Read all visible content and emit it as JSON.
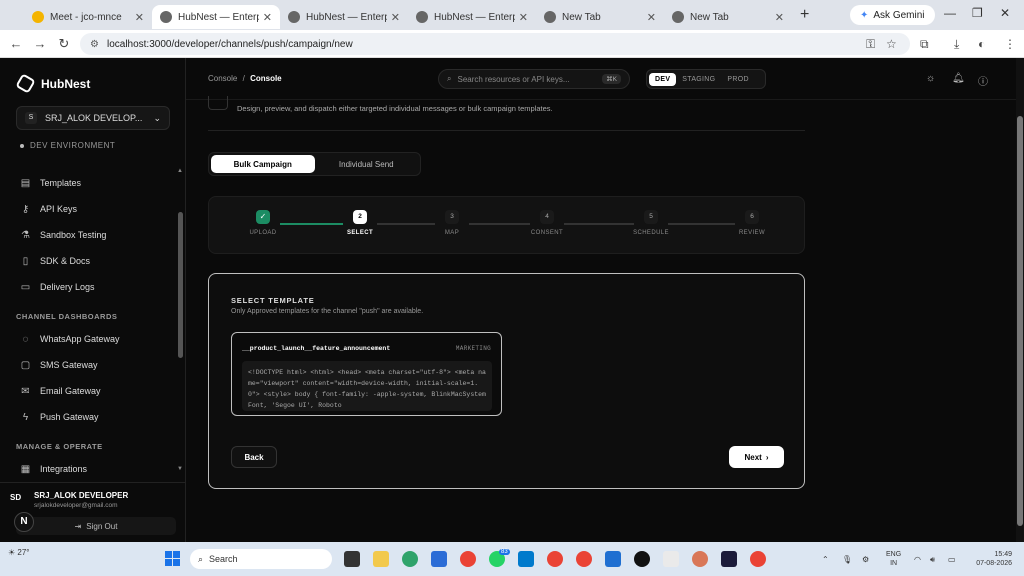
{
  "browser": {
    "tabs": [
      {
        "label": "Meet - jco-mnce",
        "color": "#f4b400",
        "active": false
      },
      {
        "label": "HubNest — Enterprise",
        "color": "#666666",
        "active": true
      },
      {
        "label": "HubNest — Enterprise",
        "color": "#666666",
        "active": false
      },
      {
        "label": "HubNest — Enterprise",
        "color": "#666666",
        "active": false
      },
      {
        "label": "New Tab",
        "color": "#666666",
        "active": false
      },
      {
        "label": "New Tab",
        "color": "#666666",
        "active": false
      }
    ],
    "ask_gemini": "Ask Gemini",
    "url": "localhost:3000/developer/channels/push/campaign/new"
  },
  "sidebar": {
    "brand": "HubNest",
    "env_avatar": "S",
    "env_select": "SRJ_ALOK DEVELOP...",
    "env_label": "DEV ENVIRONMENT",
    "items": [
      {
        "label": "Templates",
        "icon": "document-icon"
      },
      {
        "label": "API Keys",
        "icon": "key-icon"
      },
      {
        "label": "Sandbox Testing",
        "icon": "flask-icon"
      },
      {
        "label": "SDK & Docs",
        "icon": "book-icon"
      },
      {
        "label": "Delivery Logs",
        "icon": "file-icon"
      }
    ],
    "section_channels": "CHANNEL DASHBOARDS",
    "channels": [
      {
        "label": "WhatsApp Gateway",
        "icon": "chat-icon"
      },
      {
        "label": "SMS Gateway",
        "icon": "message-icon"
      },
      {
        "label": "Email Gateway",
        "icon": "mail-icon"
      },
      {
        "label": "Push Gateway",
        "icon": "bolt-icon"
      }
    ],
    "section_manage": "MANAGE & OPERATE",
    "manage": [
      {
        "label": "Integrations",
        "icon": "grid-icon"
      }
    ],
    "user": {
      "initials": "SD",
      "name": "SRJ_ALOK DEVELOPER",
      "email": "srjalokdeveloper@gmail.com",
      "sign_out": "Sign Out"
    }
  },
  "topbar": {
    "crumb_root": "Console",
    "crumb_sep": "/",
    "crumb_current": "Console",
    "search_placeholder": "Search resources or API keys...",
    "search_kbd": "⌘K",
    "env_tabs": [
      "DEV",
      "STAGING",
      "PROD"
    ],
    "env_active": "DEV"
  },
  "main": {
    "description": "Design, preview, and dispatch either targeted individual messages or bulk campaign templates.",
    "mode_tabs": [
      "Bulk Campaign",
      "Individual Send"
    ],
    "mode_active": "Bulk Campaign",
    "steps": [
      {
        "num": "✓",
        "label": "UPLOAD",
        "state": "done"
      },
      {
        "num": "2",
        "label": "SELECT",
        "state": "current"
      },
      {
        "num": "3",
        "label": "MAP",
        "state": "pending"
      },
      {
        "num": "4",
        "label": "CONSENT",
        "state": "pending"
      },
      {
        "num": "5",
        "label": "SCHEDULE",
        "state": "pending"
      },
      {
        "num": "6",
        "label": "REVIEW",
        "state": "pending"
      }
    ],
    "card": {
      "title": "SELECT TEMPLATE",
      "subtitle": "Only Approved templates for the channel \"push\" are available.",
      "template": {
        "name": "__product_launch__feature_announcement",
        "category": "MARKETING",
        "code": "<!DOCTYPE html> <html> <head> <meta charset=\"utf-8\"> <meta name=\"viewport\" content=\"width=device-width, initial-scale=1.0\"> <style> body { font-family: -apple-system, BlinkMacSystemFont, 'Segoe UI', Roboto"
      },
      "back": "Back",
      "next": "Next"
    }
  },
  "taskbar": {
    "weather": "27°",
    "search": "Search",
    "lang": [
      "ENG",
      "IN"
    ],
    "time": "15:49",
    "date": "07-08-2026",
    "badge": "83"
  }
}
